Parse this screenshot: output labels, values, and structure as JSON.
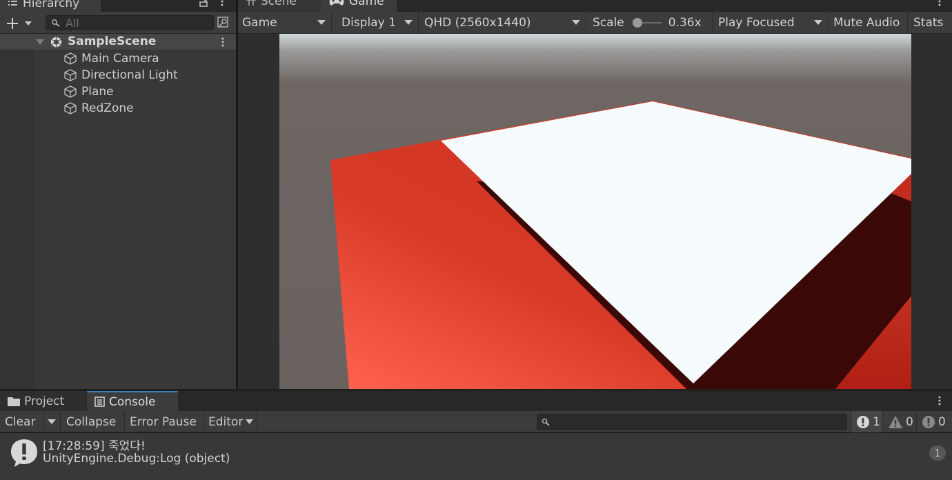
{
  "hierarchy": {
    "tab_label": "Hierarchy",
    "search_placeholder": "All",
    "scene_name": "SampleScene",
    "items": [
      {
        "label": "Main Camera"
      },
      {
        "label": "Directional Light"
      },
      {
        "label": "Plane"
      },
      {
        "label": "RedZone"
      }
    ]
  },
  "tabs": {
    "scene_label": "Scene",
    "game_label": "Game"
  },
  "game_toolbar": {
    "view_select": "Game",
    "display_select": "Display 1",
    "resolution_select": "QHD (2560x1440)",
    "scale_label": "Scale",
    "scale_value_text": "0.36x",
    "scale_slider_fraction": 0.0,
    "play_focused": "Play Focused",
    "mute_audio": "Mute Audio",
    "stats": "Stats"
  },
  "bottom_tabs": {
    "project_label": "Project",
    "console_label": "Console"
  },
  "console_toolbar": {
    "clear": "Clear",
    "collapse": "Collapse",
    "error_pause": "Error Pause",
    "editor": "Editor",
    "log_count": "1",
    "warning_count": "0",
    "error_count": "0"
  },
  "console": {
    "entries": [
      {
        "line1": "[17:28:59] 죽었다!",
        "line2": "UnityEngine.Debug:Log (object)",
        "count": "1"
      }
    ]
  },
  "colors": {
    "panel": "#383838",
    "toolbar": "#3c3c3c",
    "red_zone": "#d43a26",
    "plane_white": "#f7fbfd",
    "sky": "#6b625e"
  }
}
